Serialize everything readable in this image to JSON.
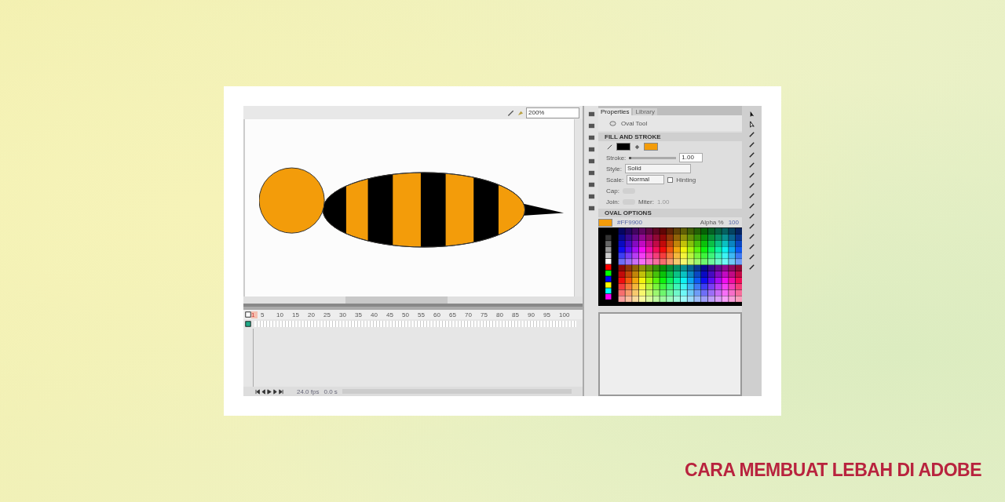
{
  "title": "CARA MEMBUAT LEBAH DI ADOBE",
  "app": {
    "zoom": "200%",
    "panel_tabs": [
      {
        "label": "Properties",
        "selected": true
      },
      {
        "label": "Library",
        "selected": false
      }
    ],
    "tool_name": "Oval Tool",
    "fill_and_stroke": {
      "heading": "FILL AND STROKE",
      "stroke_label": "Stroke:",
      "stroke_slider": {
        "level": 0.05
      },
      "stroke_value": "1.00",
      "style_label": "Style:",
      "style_value": "Solid",
      "scale_label": "Scale:",
      "scale_value": "Normal",
      "hinting_label": "Hinting",
      "hinting_checked": false,
      "cap_label": "Cap:",
      "join_label": "Join:",
      "miter_label": "Miter:",
      "miter_value": "1.00"
    },
    "oval_options": {
      "heading": "OVAL OPTIONS",
      "hex": "#FF9900",
      "alpha_label": "Alpha %",
      "alpha_value": "100"
    },
    "timeline": {
      "frame_numbers": [
        "1",
        "5",
        "10",
        "15",
        "20",
        "25",
        "30",
        "35",
        "40",
        "45",
        "50",
        "55",
        "60",
        "65",
        "70",
        "75",
        "80",
        "85",
        "90",
        "95",
        "100"
      ],
      "fps": "24.0 fps",
      "time": "0.0 s"
    }
  }
}
